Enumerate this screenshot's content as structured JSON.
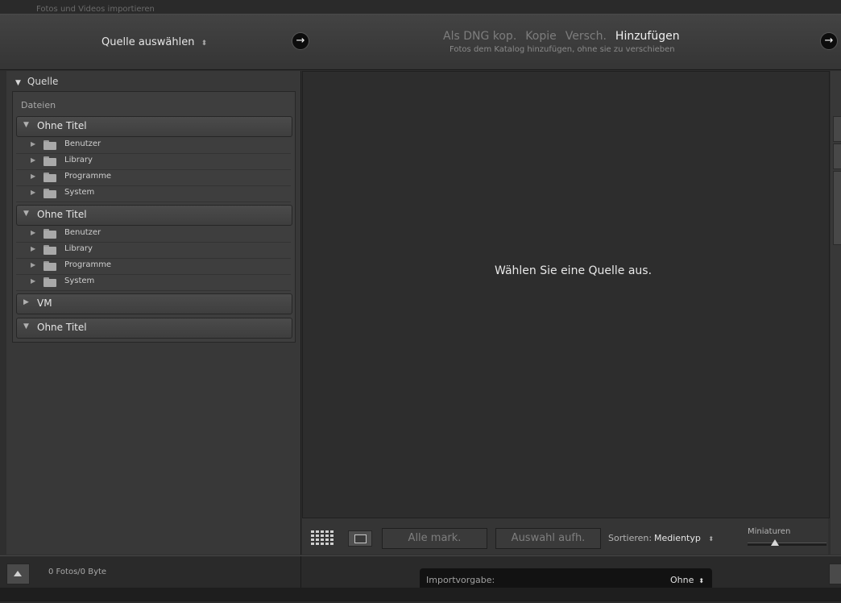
{
  "background_window": {
    "title": "Fotos und Videos importieren"
  },
  "topbar": {
    "source_select": "Quelle auswählen",
    "updown_glyph": "⬍",
    "arrow_glyph": "→",
    "modes": [
      {
        "label": "Als DNG kop.",
        "active": false
      },
      {
        "label": "Kopie",
        "active": false
      },
      {
        "label": "Versch.",
        "active": false
      },
      {
        "label": "Hinzufügen",
        "active": true
      }
    ],
    "mode_description": "Fotos dem Katalog hinzufügen, ohne sie zu verschieben"
  },
  "left_panel": {
    "header": "Quelle",
    "files_label": "Dateien",
    "volumes": [
      {
        "name": "Ohne Titel",
        "expanded": true,
        "folders": [
          "Benutzer",
          "Library",
          "Programme",
          "System"
        ]
      },
      {
        "name": "Ohne Titel",
        "expanded": true,
        "folders": [
          "Benutzer",
          "Library",
          "Programme",
          "System"
        ]
      },
      {
        "name": "VM",
        "expanded": false,
        "folders": []
      },
      {
        "name": "Ohne Titel",
        "expanded": true,
        "folders": []
      }
    ]
  },
  "main": {
    "empty_message": "Wählen Sie eine Quelle aus."
  },
  "toolbar": {
    "check_all": "Alle mark.",
    "uncheck_all": "Auswahl aufh.",
    "sort_label": "Sortieren:",
    "sort_value": "Medientyp",
    "thumbnails_label": "Miniaturen",
    "thumbnail_size": 0.35
  },
  "footer": {
    "count": "0 Fotos/0 Byte",
    "import_preset_label": "Importvorgabe:",
    "import_preset_value": "Ohne"
  },
  "colors": {
    "background": "#2f2f2f",
    "active_text": "#f0f0f0",
    "inactive_text": "#7d7d7d"
  },
  "icons": [
    "updown-icon",
    "arrow-right-icon",
    "grid-view-icon",
    "loupe-view-icon",
    "folder-icon",
    "disclosure-triangle-icon",
    "up-triangle-icon"
  ]
}
